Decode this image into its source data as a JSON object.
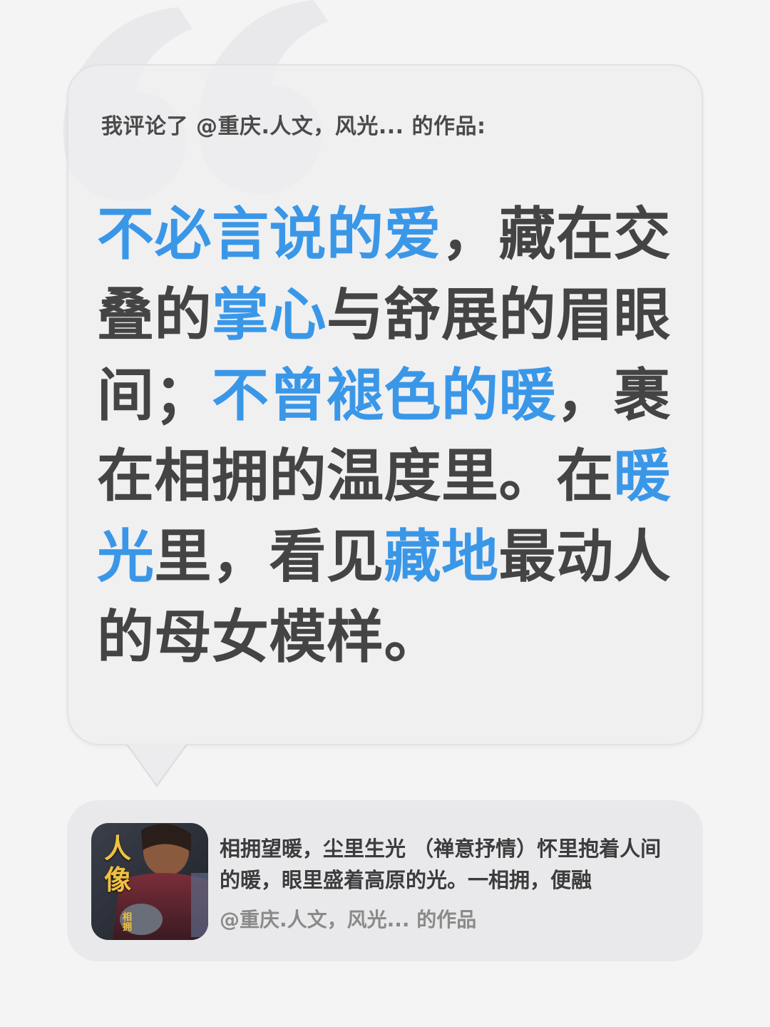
{
  "intro": "我评论了 @重庆.人文，风光... 的作品:",
  "comment": {
    "segments": [
      {
        "text": "不必言说的爱",
        "highlight": true
      },
      {
        "text": "，藏在交叠的",
        "highlight": false
      },
      {
        "text": "掌心",
        "highlight": true
      },
      {
        "text": "与舒展的眉眼间；",
        "highlight": false
      },
      {
        "text": "不曾褪色的暖",
        "highlight": true
      },
      {
        "text": "，裹在相拥的温度里。在",
        "highlight": false
      },
      {
        "text": "暖光",
        "highlight": true
      },
      {
        "text": "里，看见",
        "highlight": false
      },
      {
        "text": "藏地",
        "highlight": true
      },
      {
        "text": "最动人的母女模样。",
        "highlight": false
      }
    ]
  },
  "card": {
    "text": "相拥望暖，尘里生光 （禅意抒情）怀里抱着人间的暖，眼里盛着高原的光。一相拥，便融",
    "author": "@重庆.人文，风光... 的作品",
    "thumb_title": "人像",
    "thumb_sub": "相拥"
  },
  "colors": {
    "highlight": "#3a97e8",
    "text": "#444444",
    "background": "#f4f4f5"
  }
}
